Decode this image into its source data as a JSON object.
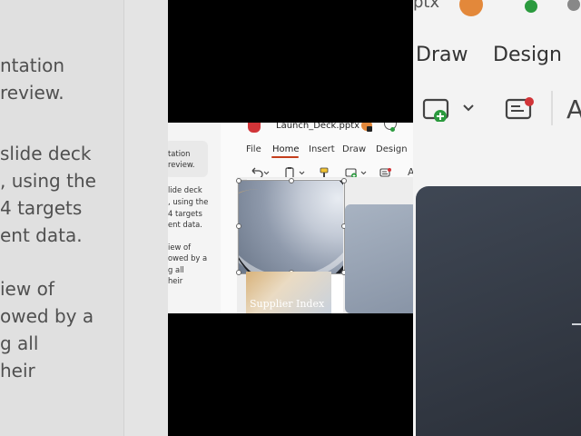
{
  "background": {
    "chat_lines": [
      "ntation",
      "review.",
      "slide deck",
      ", using the",
      "4 targets",
      "ent data.",
      "iew of",
      "owed by a",
      "g all",
      "heir"
    ],
    "file_name_fragment": "ptx",
    "tabs": [
      "Draw",
      "Design"
    ]
  },
  "chat": {
    "bubble_lines": [
      "tation",
      "review."
    ],
    "lines": [
      "lide deck",
      ", using the",
      "4 targets",
      "ent data.",
      "iew of",
      "owed by a",
      "g all",
      "heir"
    ]
  },
  "window": {
    "title": "Launch_Deck.pptx"
  },
  "ribbon": {
    "tabs": [
      {
        "label": "File",
        "active": false
      },
      {
        "label": "Home",
        "active": true
      },
      {
        "label": "Insert",
        "active": false
      },
      {
        "label": "Draw",
        "active": false
      },
      {
        "label": "Design",
        "active": false
      }
    ],
    "tools": {
      "undo": "undo-icon",
      "clipboard": "clipboard-icon",
      "format_painter": "format-painter-icon",
      "new_slide": "new-slide-icon",
      "designer": "designer-icon"
    }
  },
  "slides": {
    "supplier_title": "Supplier Index"
  },
  "colors": {
    "accent": "#c43e1c",
    "app_icon": "#d13438",
    "sync_ok": "#2b9a3e"
  }
}
